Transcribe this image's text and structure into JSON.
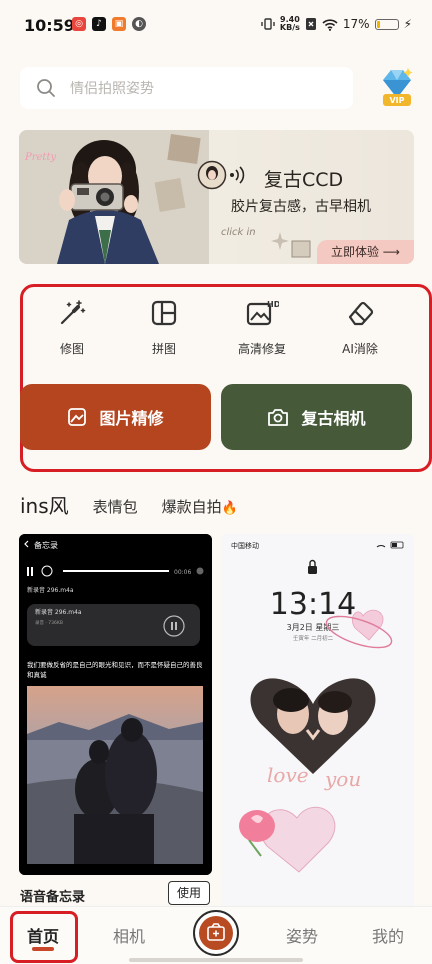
{
  "status": {
    "time": "10:59",
    "speed_top": "9.40",
    "speed_bottom": "KB/s",
    "battery": "17%",
    "battery_level": 0.17
  },
  "search": {
    "placeholder": "情侣拍照姿势"
  },
  "vip": {
    "label": "VIP"
  },
  "banner": {
    "title": "复古CCD",
    "subtitle": "胶片复古感，古早相机",
    "cta": "立即体验 ⟶",
    "sticker_text": "click in",
    "pretty_text": "Pretty"
  },
  "tools": [
    {
      "label": "修图",
      "icon": "magic-wand-icon"
    },
    {
      "label": "拼图",
      "icon": "collage-icon"
    },
    {
      "label": "高清修复",
      "icon": "hd-restore-icon"
    },
    {
      "label": "AI消除",
      "icon": "eraser-icon"
    }
  ],
  "actions": {
    "edit": "图片精修",
    "camera": "复古相机"
  },
  "tabs": {
    "active": "ins风",
    "items": [
      "表情包",
      "爆款自拍"
    ],
    "fire": "🔥"
  },
  "card_left": {
    "back": "备忘录",
    "duration": "00:06",
    "file1": "新录音 296.m4a",
    "file2": "新录音 296.m4a",
    "file2_meta": "录音 · 736KB",
    "quote": "我们要做反省的是自己的眼光和见识，而不是怀疑自己的善良和真诚",
    "title": "语音备忘录",
    "use": "使用"
  },
  "card_right": {
    "carrier": "中国移动",
    "clock": "13:14",
    "date": "3月2日 星期三",
    "lunar": "壬寅年 二月初二",
    "love1": "love",
    "love2": "you"
  },
  "nav": {
    "home": "首页",
    "camera": "相机",
    "pose": "姿势",
    "mine": "我的"
  },
  "colors": {
    "accent": "#b4451f",
    "camera_green": "#465a3a",
    "highlight": "#d81e25",
    "background": "#fcf8f3"
  }
}
